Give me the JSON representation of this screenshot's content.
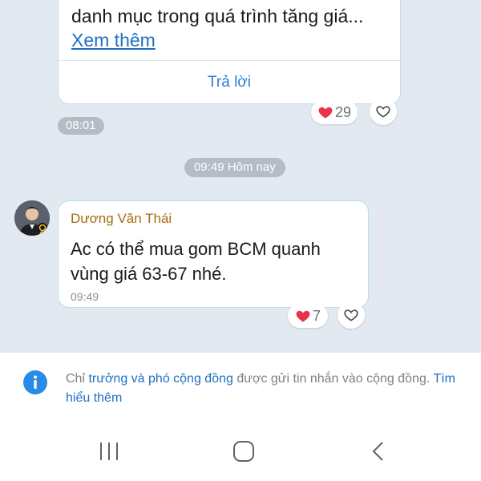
{
  "message_1": {
    "lines": [
      "danh mục trong quá trình tăng giá..."
    ],
    "see_more": "Xem thêm",
    "reply": "Trả lời",
    "reaction_count": "29",
    "time": "08:01"
  },
  "date_separator": "09:49 Hôm nay",
  "message_2": {
    "sender": "Dương Văn Thái",
    "lines": [
      "Ac có thể mua gom BCM quanh",
      "vùng giá 63-67 nhé."
    ],
    "time": "09:49",
    "reaction_count": "7"
  },
  "notice": {
    "part1": "Chỉ ",
    "highlight": "trưởng và phó cộng đồng",
    "part2": " được gửi tin nhắn vào cộng đồng. ",
    "link": "Tìm hiểu thêm"
  },
  "nav": {
    "recents_icon": "recents-icon",
    "home_icon": "home-icon",
    "back_icon": "back-icon"
  },
  "colors": {
    "chat_background": "#e2e9f1",
    "link": "#1f6fc3",
    "sender_name": "#a56d11",
    "reaction_heart": "#e8334a"
  }
}
